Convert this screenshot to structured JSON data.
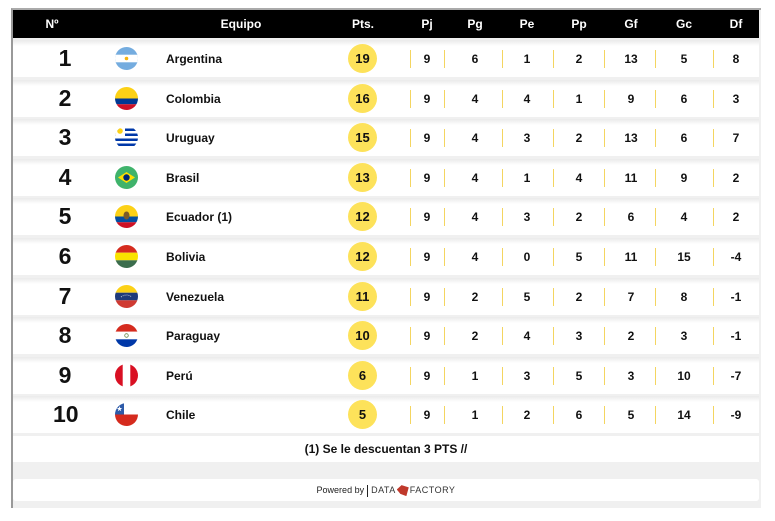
{
  "header": {
    "pos": "Nº",
    "team": "Equipo",
    "pts": "Pts.",
    "pj": "Pj",
    "pg": "Pg",
    "pe": "Pe",
    "pp": "Pp",
    "gf": "Gf",
    "gc": "Gc",
    "df": "Df"
  },
  "rows": [
    {
      "pos": "1",
      "flag": "argentina-flag",
      "team": "Argentina",
      "pts": "19",
      "pj": "9",
      "pg": "6",
      "pe": "1",
      "pp": "2",
      "gf": "13",
      "gc": "5",
      "df": "8"
    },
    {
      "pos": "2",
      "flag": "colombia-flag",
      "team": "Colombia",
      "pts": "16",
      "pj": "9",
      "pg": "4",
      "pe": "4",
      "pp": "1",
      "gf": "9",
      "gc": "6",
      "df": "3"
    },
    {
      "pos": "3",
      "flag": "uruguay-flag",
      "team": "Uruguay",
      "pts": "15",
      "pj": "9",
      "pg": "4",
      "pe": "3",
      "pp": "2",
      "gf": "13",
      "gc": "6",
      "df": "7"
    },
    {
      "pos": "4",
      "flag": "brasil-flag",
      "team": "Brasil",
      "pts": "13",
      "pj": "9",
      "pg": "4",
      "pe": "1",
      "pp": "4",
      "gf": "11",
      "gc": "9",
      "df": "2"
    },
    {
      "pos": "5",
      "flag": "ecuador-flag",
      "team": "Ecuador (1)",
      "pts": "12",
      "pj": "9",
      "pg": "4",
      "pe": "3",
      "pp": "2",
      "gf": "6",
      "gc": "4",
      "df": "2"
    },
    {
      "pos": "6",
      "flag": "bolivia-flag",
      "team": "Bolivia",
      "pts": "12",
      "pj": "9",
      "pg": "4",
      "pe": "0",
      "pp": "5",
      "gf": "11",
      "gc": "15",
      "df": "-4"
    },
    {
      "pos": "7",
      "flag": "venezuela-flag",
      "team": "Venezuela",
      "pts": "11",
      "pj": "9",
      "pg": "2",
      "pe": "5",
      "pp": "2",
      "gf": "7",
      "gc": "8",
      "df": "-1"
    },
    {
      "pos": "8",
      "flag": "paraguay-flag",
      "team": "Paraguay",
      "pts": "10",
      "pj": "9",
      "pg": "2",
      "pe": "4",
      "pp": "3",
      "gf": "2",
      "gc": "3",
      "df": "-1"
    },
    {
      "pos": "9",
      "flag": "peru-flag",
      "team": "Perú",
      "pts": "6",
      "pj": "9",
      "pg": "1",
      "pe": "3",
      "pp": "5",
      "gf": "3",
      "gc": "10",
      "df": "-7"
    },
    {
      "pos": "10",
      "flag": "chile-flag",
      "team": "Chile",
      "pts": "5",
      "pj": "9",
      "pg": "1",
      "pe": "2",
      "pp": "6",
      "gf": "5",
      "gc": "14",
      "df": "-9"
    }
  ],
  "note": "(1) Se le descuentan 3 PTS //",
  "footer": {
    "powered": "Powered by",
    "brand_left": "DATA",
    "brand_right": "FACTORY"
  },
  "colors": {
    "header_bg": "#000000",
    "points_badge": "#fde25a",
    "separator": "#f4d560"
  }
}
